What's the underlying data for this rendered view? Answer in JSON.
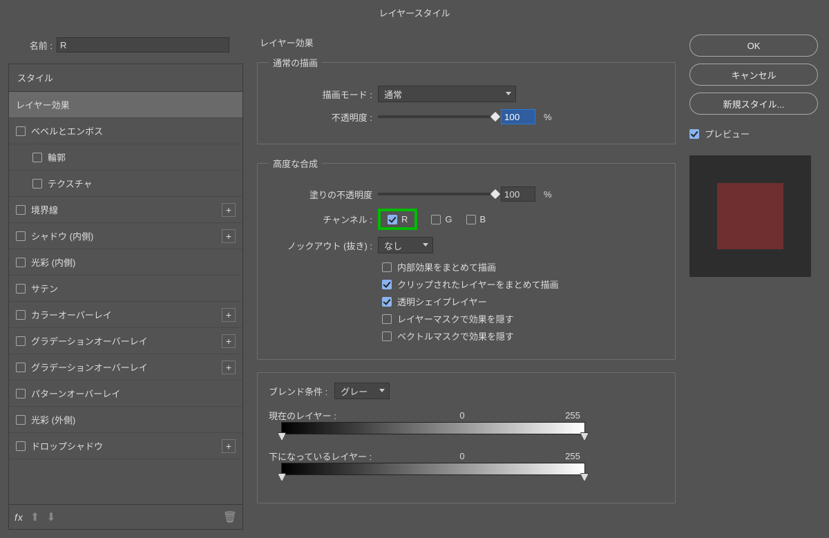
{
  "dialog_title": "レイヤースタイル",
  "name_label": "名前 :",
  "name_value": "R",
  "sidebar": {
    "header": "スタイル",
    "items": [
      {
        "label": "レイヤー効果",
        "selected": true,
        "check": null,
        "plus": false,
        "sub": false
      },
      {
        "label": "ベベルとエンボス",
        "selected": false,
        "check": false,
        "plus": false,
        "sub": false
      },
      {
        "label": "輪郭",
        "selected": false,
        "check": false,
        "plus": false,
        "sub": true
      },
      {
        "label": "テクスチャ",
        "selected": false,
        "check": false,
        "plus": false,
        "sub": true
      },
      {
        "label": "境界線",
        "selected": false,
        "check": false,
        "plus": true,
        "sub": false
      },
      {
        "label": "シャドウ (内側)",
        "selected": false,
        "check": false,
        "plus": true,
        "sub": false
      },
      {
        "label": "光彩 (内側)",
        "selected": false,
        "check": false,
        "plus": false,
        "sub": false
      },
      {
        "label": "サテン",
        "selected": false,
        "check": false,
        "plus": false,
        "sub": false
      },
      {
        "label": "カラーオーバーレイ",
        "selected": false,
        "check": false,
        "plus": true,
        "sub": false
      },
      {
        "label": "グラデーションオーバーレイ",
        "selected": false,
        "check": false,
        "plus": true,
        "sub": false
      },
      {
        "label": "グラデーションオーバーレイ",
        "selected": false,
        "check": false,
        "plus": true,
        "sub": false
      },
      {
        "label": "パターンオーバーレイ",
        "selected": false,
        "check": false,
        "plus": false,
        "sub": false
      },
      {
        "label": "光彩 (外側)",
        "selected": false,
        "check": false,
        "plus": false,
        "sub": false
      },
      {
        "label": "ドロップシャドウ",
        "selected": false,
        "check": false,
        "plus": true,
        "sub": false
      }
    ],
    "footer_fx": "fx"
  },
  "main": {
    "section_title": "レイヤー効果",
    "normal_group": {
      "title": "通常の描画",
      "blend_mode_label": "描画モード :",
      "blend_mode_value": "通常",
      "opacity_label": "不透明度 :",
      "opacity_value": "100",
      "pct": "%"
    },
    "advanced_group": {
      "title": "高度な合成",
      "fill_opacity_label": "塗りの不透明度",
      "fill_opacity_value": "100",
      "pct": "%",
      "channel_label": "チャンネル :",
      "channels": {
        "R": true,
        "G": false,
        "B": false
      },
      "knockout_label": "ノックアウト (抜き) :",
      "knockout_value": "なし",
      "checks": [
        {
          "label": "内部効果をまとめて描画",
          "checked": false
        },
        {
          "label": "クリップされたレイヤーをまとめて描画",
          "checked": true
        },
        {
          "label": "透明シェイプレイヤー",
          "checked": true
        },
        {
          "label": "レイヤーマスクで効果を隠す",
          "checked": false
        },
        {
          "label": "ベクトルマスクで効果を隠す",
          "checked": false
        }
      ]
    },
    "blendif_group": {
      "title": "ブレンド条件 :",
      "channel_value": "グレー",
      "this_layer_label": "現在のレイヤー :",
      "this_layer_low": "0",
      "this_layer_high": "255",
      "under_layer_label": "下になっているレイヤー :",
      "under_layer_low": "0",
      "under_layer_high": "255"
    }
  },
  "right": {
    "ok": "OK",
    "cancel": "キャンセル",
    "new_style": "新規スタイル...",
    "preview_label": "プレビュー",
    "preview_checked": true,
    "swatch_color": "#6d2f2f"
  }
}
